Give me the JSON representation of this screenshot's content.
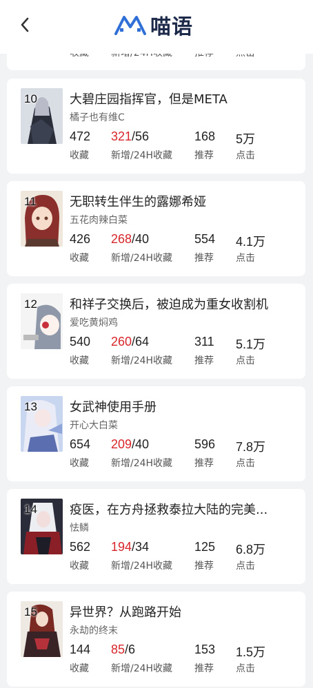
{
  "header": {
    "app_name": "喵语",
    "back_icon": "chevron-left-icon",
    "logo_icon": "logo-icon",
    "accent": "#2f6fd6"
  },
  "labels": {
    "favorites": "收藏",
    "new_24h": "新增/24H收藏",
    "recommend": "推荐",
    "clicks": "点击"
  },
  "cards": [
    {
      "rank": "10",
      "title": "大碧庄园指挥官，但是META",
      "author": "橘子也有维C",
      "favorites": "472",
      "new_24h": "321",
      "fav_24h": "/56",
      "recommend": "168",
      "clicks": "5万"
    },
    {
      "rank": "11",
      "title": "无职转生伴生的露娜希娅",
      "author": "五花肉辣白菜",
      "favorites": "426",
      "new_24h": "268",
      "fav_24h": "/40",
      "recommend": "554",
      "clicks": "4.1万"
    },
    {
      "rank": "12",
      "title": "和祥子交换后，被迫成为重女收割机",
      "author": "爱吃黄焖鸡",
      "favorites": "540",
      "new_24h": "260",
      "fav_24h": "/64",
      "recommend": "311",
      "clicks": "5.1万"
    },
    {
      "rank": "13",
      "title": "女武神使用手册",
      "author": "开心大白菜",
      "favorites": "654",
      "new_24h": "209",
      "fav_24h": "/40",
      "recommend": "596",
      "clicks": "7.8万"
    },
    {
      "rank": "14",
      "title": "疫医，在方舟拯救泰拉大陆的完美...",
      "author": "怯鳞",
      "favorites": "562",
      "new_24h": "194",
      "fav_24h": "/34",
      "recommend": "125",
      "clicks": "6.8万"
    },
    {
      "rank": "15",
      "title": "异世界？从跑路开始",
      "author": "永劫的终末",
      "favorites": "144",
      "new_24h": "85",
      "fav_24h": "/6",
      "recommend": "153",
      "clicks": "1.5万"
    }
  ]
}
